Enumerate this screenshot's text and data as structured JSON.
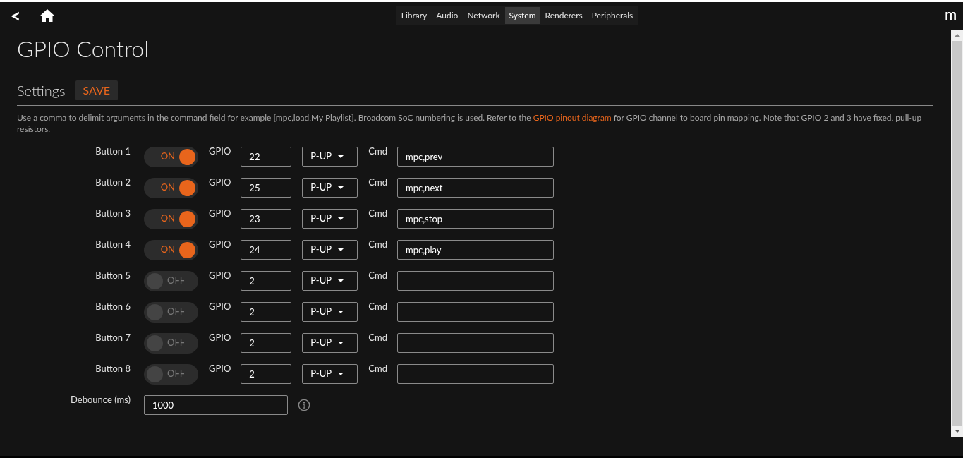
{
  "nav": {
    "back": "<",
    "logo": "m"
  },
  "tabs": [
    {
      "label": "Library",
      "selected": false
    },
    {
      "label": "Audio",
      "selected": false
    },
    {
      "label": "Network",
      "selected": false
    },
    {
      "label": "System",
      "selected": true
    },
    {
      "label": "Renderers",
      "selected": false
    },
    {
      "label": "Peripherals",
      "selected": false
    }
  ],
  "title": "GPIO Control",
  "section": {
    "title": "Settings",
    "save": "SAVE"
  },
  "description": {
    "before": "Use a comma to delimit arguments in the command field for example [mpc,load,My Playlist]. Broadcom SoC numbering is used. Refer to the ",
    "link": "GPIO pinout diagram",
    "after": " for GPIO channel to board pin mapping. Note that GPIO 2 and 3 have fixed, pull-up resistors."
  },
  "buttons": [
    {
      "label": "Button 1",
      "on": true,
      "state": "ON",
      "gpio_label": "GPIO",
      "gpio": "22",
      "pull": "P-UP",
      "cmd_label": "Cmd",
      "cmd": "mpc,prev"
    },
    {
      "label": "Button 2",
      "on": true,
      "state": "ON",
      "gpio_label": "GPIO",
      "gpio": "25",
      "pull": "P-UP",
      "cmd_label": "Cmd",
      "cmd": "mpc,next"
    },
    {
      "label": "Button 3",
      "on": true,
      "state": "ON",
      "gpio_label": "GPIO",
      "gpio": "23",
      "pull": "P-UP",
      "cmd_label": "Cmd",
      "cmd": "mpc,stop"
    },
    {
      "label": "Button 4",
      "on": true,
      "state": "ON",
      "gpio_label": "GPIO",
      "gpio": "24",
      "pull": "P-UP",
      "cmd_label": "Cmd",
      "cmd": "mpc,play"
    },
    {
      "label": "Button 5",
      "on": false,
      "state": "OFF",
      "gpio_label": "GPIO",
      "gpio": "2",
      "pull": "P-UP",
      "cmd_label": "Cmd"
    },
    {
      "label": "Button 6",
      "on": false,
      "state": "OFF",
      "gpio_label": "GPIO",
      "gpio": "2",
      "pull": "P-UP",
      "cmd_label": "Cmd"
    },
    {
      "label": "Button 7",
      "on": false,
      "state": "OFF",
      "gpio_label": "GPIO",
      "gpio": "2",
      "pull": "P-UP",
      "cmd_label": "Cmd"
    },
    {
      "label": "Button 8",
      "on": false,
      "state": "OFF",
      "gpio_label": "GPIO",
      "gpio": "2",
      "pull": "P-UP",
      "cmd_label": "Cmd"
    }
  ],
  "debounce": {
    "label": "Debounce (ms)",
    "value": "1000"
  }
}
